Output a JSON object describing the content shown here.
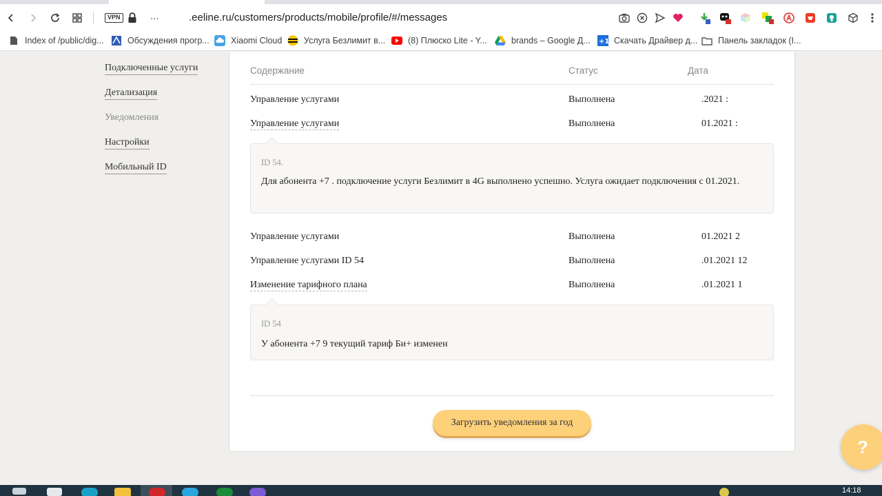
{
  "browser": {
    "url_prefix": "...",
    "url": ".eeline.ru/customers/products/mobile/profile/#/messages",
    "vpn_label": "VPN"
  },
  "bookmarks": [
    {
      "label": "Index of /public/dig...",
      "icon": "file-icon"
    },
    {
      "label": "Обсуждения прогр...",
      "icon": "forum-icon"
    },
    {
      "label": "Xiaomi Cloud",
      "icon": "cloud-icon"
    },
    {
      "label": "Услуга Безлимит в...",
      "icon": "beeline-icon"
    },
    {
      "label": "(8) Плюско Lite - Y...",
      "icon": "youtube-icon"
    },
    {
      "label": "brands – Google Д...",
      "icon": "google-drive-icon"
    },
    {
      "label": "Скачать Драйвер д...",
      "icon": "plus-one-icon"
    },
    {
      "label": "Панель закладок (I...",
      "icon": "folder-icon"
    }
  ],
  "sidebar": {
    "items": [
      {
        "label": "Подключенные услуги",
        "current": false
      },
      {
        "label": "Детализация",
        "current": false
      },
      {
        "label": "Уведомления",
        "current": true
      },
      {
        "label": "Настройки",
        "current": false
      },
      {
        "label": "Мобильный ID",
        "current": false
      }
    ]
  },
  "table": {
    "headers": {
      "content": "Содержание",
      "status": "Статус",
      "date": "Дата"
    },
    "rows": [
      {
        "content": "Управление услугами",
        "status": "Выполнена",
        "date": ".2021 :",
        "expanded": false
      },
      {
        "content": "Управление услугами",
        "status": "Выполнена",
        "date": "01.2021 :",
        "expanded": true
      },
      {
        "content": "Управление услугами",
        "status": "Выполнена",
        "date": "01.2021 2",
        "expanded": false
      },
      {
        "content": "Управление услугами ID 54",
        "status": "Выполнена",
        "date": ".01.2021 12",
        "expanded": false
      },
      {
        "content": "Изменение тарифного плана",
        "status": "Выполнена",
        "date": ".01.2021 1",
        "expanded": true
      }
    ],
    "details": [
      {
        "id": "ID 54.",
        "text": "Для абонента +7           . подключение услуги Безлимит в 4G выполнено успешно. Услуга ожидает подключения с      01.2021."
      },
      {
        "id": "ID 54",
        "text": "У абонента +7 9               текущий тариф Би+ изменен"
      }
    ]
  },
  "load_button": {
    "label": "Загрузить уведомления за год"
  },
  "help_button": {
    "label": "?"
  },
  "taskbar": {
    "time": "14:18"
  },
  "colors": {
    "accent": "#fdd07a",
    "page_bg": "#f0efed",
    "taskbar": "#1f3340"
  }
}
